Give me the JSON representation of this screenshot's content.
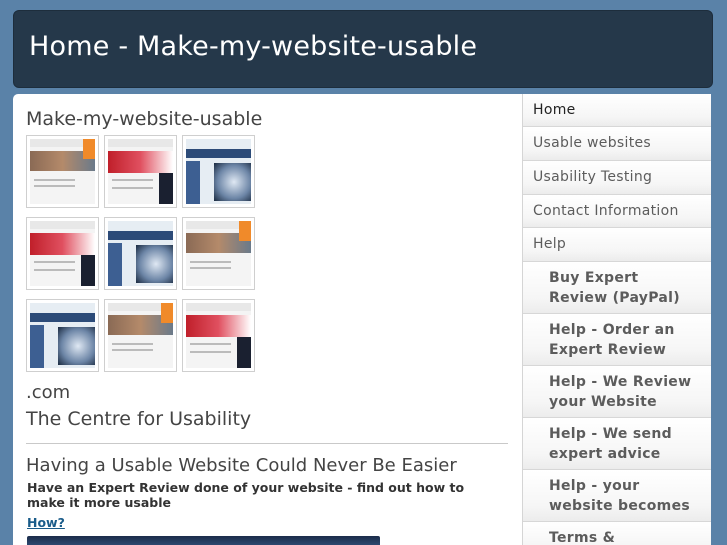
{
  "header": {
    "title": "Home - Make-my-website-usable"
  },
  "main": {
    "site_title": "Make-my-website-usable",
    "domain_suffix": ".com",
    "tagline": "The Centre for Usability",
    "heading": "Having a Usable Website Could Never Be Easier",
    "subheading": "Have an Expert Review done of your website - find out how to make it more usable",
    "how_link": "How?"
  },
  "sidebar": {
    "items": [
      {
        "label": "Home",
        "active": true
      },
      {
        "label": "Usable websites"
      },
      {
        "label": "Usability Testing"
      },
      {
        "label": "Contact Information"
      },
      {
        "label": "Help"
      },
      {
        "label": "Buy Expert Review (PayPal)"
      },
      {
        "label": "Help - Order an Expert Review"
      },
      {
        "label": "Help - We Review your Website"
      },
      {
        "label": "Help - We send expert advice"
      },
      {
        "label": "Help - your website becomes"
      },
      {
        "label": "Terms & Conditions"
      }
    ]
  }
}
